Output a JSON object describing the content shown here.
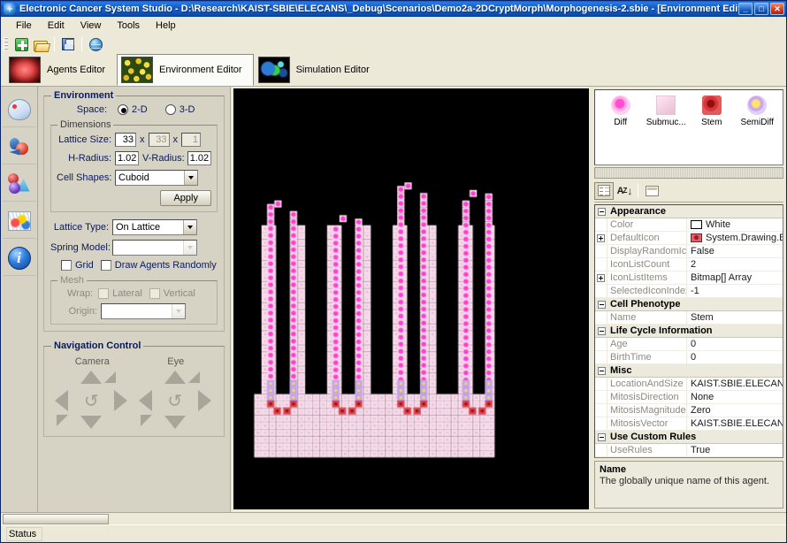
{
  "window": {
    "title": "Electronic Cancer System Studio - D:\\Research\\KAIST-SBIE\\ELECANS\\_Debug\\Scenarios\\Demo2a-2DCryptMorph\\Morphogenesis-2.sbie - [Environment Editor]",
    "minimize_label": "_",
    "maximize_label": "□",
    "close_label": "✕"
  },
  "menu": {
    "items": [
      {
        "label": "File"
      },
      {
        "label": "Edit"
      },
      {
        "label": "View"
      },
      {
        "label": "Tools"
      },
      {
        "label": "Help"
      }
    ]
  },
  "toolbar": {
    "buttons": [
      {
        "name": "new-icon",
        "tooltip": "New"
      },
      {
        "name": "open-icon",
        "tooltip": "Open"
      },
      {
        "name": "save-icon",
        "tooltip": "Save"
      },
      {
        "name": "web-icon",
        "tooltip": "Web"
      }
    ]
  },
  "editor_tabs": [
    {
      "label": "Agents Editor",
      "active": false
    },
    {
      "label": "Environment Editor",
      "active": true
    },
    {
      "label": "Simulation Editor",
      "active": false
    }
  ],
  "rail": {
    "items": [
      {
        "name": "palette-icon",
        "tooltip": "Appearance"
      },
      {
        "name": "agents-icon",
        "tooltip": "Agents"
      },
      {
        "name": "shapes-icon",
        "tooltip": "Shapes"
      },
      {
        "name": "surface-plot-icon",
        "tooltip": "Surface"
      },
      {
        "name": "info-icon",
        "tooltip": "Info"
      }
    ]
  },
  "environment": {
    "legend": "Environment",
    "space_label": "Space:",
    "space_options": [
      {
        "label": "2-D",
        "selected": true
      },
      {
        "label": "3-D",
        "selected": false
      }
    ],
    "dimensions": {
      "legend": "Dimensions",
      "lattice_size_label": "Lattice Size:",
      "lattice_x": "33",
      "lattice_y": "33",
      "lattice_z": "1",
      "times": "x",
      "h_radius_label": "H-Radius:",
      "h_radius": "1.02",
      "v_radius_label": "V-Radius:",
      "v_radius": "1.02",
      "cell_shapes_label": "Cell Shapes:",
      "cell_shapes_value": "Cuboid",
      "apply_label": "Apply"
    },
    "lattice_type_label": "Lattice Type:",
    "lattice_type_value": "On Lattice",
    "spring_model_label": "Spring Model:",
    "spring_model_value": "",
    "grid_label": "Grid",
    "grid_checked": false,
    "draw_random_label": "Draw Agents Randomly",
    "draw_random_checked": false,
    "mesh": {
      "legend": "Mesh",
      "wrap_label": "Wrap:",
      "lateral_label": "Lateral",
      "lateral_checked": false,
      "vertical_label": "Vertical",
      "vertical_checked": false,
      "origin_label": "Origin:",
      "origin_value": ""
    }
  },
  "navigation": {
    "legend": "Navigation Control",
    "camera_label": "Camera",
    "eye_label": "Eye"
  },
  "agent_palette": [
    {
      "label": "Diff",
      "glyph": "g-diff"
    },
    {
      "label": "Submuc...",
      "glyph": "g-sub"
    },
    {
      "label": "Stem",
      "glyph": "g-stem"
    },
    {
      "label": "SemiDiff",
      "glyph": "g-semi"
    }
  ],
  "property_grid": {
    "toolbar": [
      {
        "name": "categorized-button",
        "pressed": true
      },
      {
        "name": "alphabetical-button",
        "pressed": false
      },
      {
        "name": "property-pages-button",
        "pressed": false
      }
    ],
    "rows": [
      {
        "type": "category",
        "label": "Appearance",
        "expanded": true
      },
      {
        "type": "property",
        "key": "Color",
        "value": "White",
        "swatch": "white",
        "expandable": false
      },
      {
        "type": "property",
        "key": "DefaultIcon",
        "value": "System.Drawing.Bit",
        "swatch": "icon",
        "expandable": true
      },
      {
        "type": "property",
        "key": "DisplayRandomIco",
        "value": "False",
        "expandable": false
      },
      {
        "type": "property",
        "key": "IconListCount",
        "value": "2",
        "expandable": false
      },
      {
        "type": "property",
        "key": "IconListItems",
        "value": "Bitmap[] Array",
        "expandable": true
      },
      {
        "type": "property",
        "key": "SelectedIconIndex",
        "value": "-1",
        "expandable": false
      },
      {
        "type": "category",
        "label": "Cell Phenotype",
        "expanded": true
      },
      {
        "type": "property",
        "key": "Name",
        "value": "Stem",
        "expandable": false
      },
      {
        "type": "category",
        "label": "Life Cycle Information",
        "expanded": true
      },
      {
        "type": "property",
        "key": "Age",
        "value": "0",
        "expandable": false
      },
      {
        "type": "property",
        "key": "BirthTime",
        "value": "0",
        "expandable": false
      },
      {
        "type": "category",
        "label": "Misc",
        "expanded": true
      },
      {
        "type": "property",
        "key": "LocationAndSize",
        "value": "KAIST.SBIE.ELECANS.",
        "expandable": false
      },
      {
        "type": "property",
        "key": "MitosisDirection",
        "value": "None",
        "expandable": false
      },
      {
        "type": "property",
        "key": "MitosisMagnitude",
        "value": "Zero",
        "expandable": false
      },
      {
        "type": "property",
        "key": "MitosisVector",
        "value": "KAIST.SBIE.ELECANS.",
        "expandable": false
      },
      {
        "type": "category",
        "label": "Use Custom Rules",
        "expanded": true
      },
      {
        "type": "property",
        "key": "UseRules",
        "value": "True",
        "expandable": false
      }
    ],
    "help": {
      "title": "Name",
      "description": "The globally unique name of this agent."
    }
  },
  "status": {
    "text": "Status"
  },
  "viewport": {
    "background_color": "#000000",
    "tissue_color": "#f6dceb",
    "crypts": [
      {
        "left_frac": 0.078,
        "width_frac": 0.118,
        "lumen_left_frac": 0.113,
        "lumen_width_frac": 0.044,
        "top_frac": 0.265
      },
      {
        "left_frac": 0.262,
        "width_frac": 0.118,
        "lumen_left_frac": 0.297,
        "lumen_width_frac": 0.044,
        "top_frac": 0.3
      },
      {
        "left_frac": 0.446,
        "width_frac": 0.118,
        "lumen_left_frac": 0.481,
        "lumen_width_frac": 0.044,
        "top_frac": 0.222
      },
      {
        "left_frac": 0.63,
        "width_frac": 0.118,
        "lumen_left_frac": 0.665,
        "lumen_width_frac": 0.044,
        "top_frac": 0.24
      }
    ],
    "tissue_left_frac": 0.056,
    "tissue_right_frac": 0.736,
    "tissue_bottom_frac": 0.878,
    "colors": {
      "diff": "#ff3fd0",
      "diff_pale": "#f9d2e9",
      "semidiff": "#c3a4ea",
      "semidiff_core": "#f0d86a",
      "stem": "#e0424c",
      "stem_core": "#8e1616",
      "submucosa": "#f6dceb"
    }
  }
}
